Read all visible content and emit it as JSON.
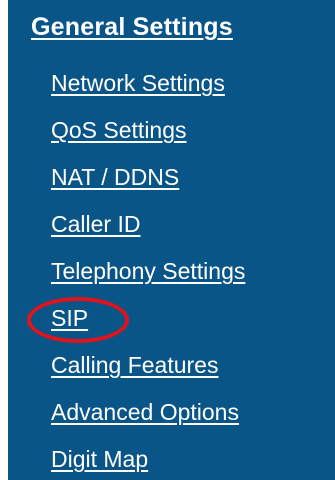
{
  "menu": {
    "header": "General Settings",
    "items": [
      {
        "label": "Network Settings"
      },
      {
        "label": "QoS Settings"
      },
      {
        "label": "NAT / DDNS"
      },
      {
        "label": "Caller ID"
      },
      {
        "label": "Telephony Settings"
      },
      {
        "label": "SIP"
      },
      {
        "label": "Calling Features"
      },
      {
        "label": "Advanced Options"
      },
      {
        "label": "Digit Map"
      }
    ],
    "highlighted_item": "SIP"
  },
  "colors": {
    "panel_background": "#0a5587",
    "link_text": "#ffffff",
    "highlight_ring": "#e0141b"
  }
}
